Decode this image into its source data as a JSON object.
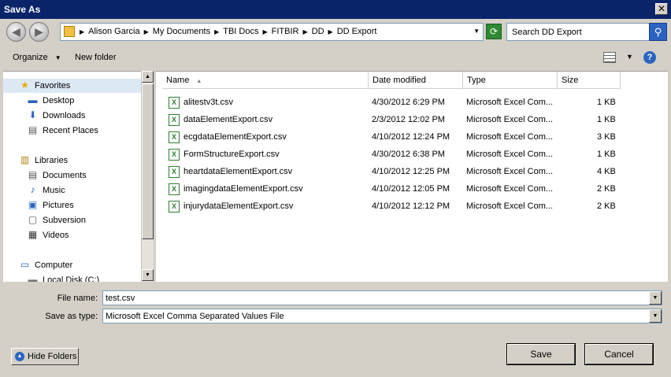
{
  "window": {
    "title": "Save As",
    "close_glyph": "✕"
  },
  "nav": {
    "back_glyph": "◀",
    "forward_glyph": "▶",
    "breadcrumbs": [
      "Alison Garcia",
      "My Documents",
      "TBI Docs",
      "FITBIR",
      "DD",
      "DD Export"
    ],
    "search_placeholder": "Search DD Export"
  },
  "toolbar": {
    "organize_label": "Organize",
    "new_folder_label": "New folder",
    "help_glyph": "?"
  },
  "sidebar": {
    "items": [
      {
        "label": "Favorites",
        "icon": "star-icon",
        "glyph": "★"
      },
      {
        "label": "Desktop",
        "icon": "desktop-icon",
        "glyph": "▬"
      },
      {
        "label": "Downloads",
        "icon": "downloads-icon",
        "glyph": "⬇"
      },
      {
        "label": "Recent Places",
        "icon": "recent-places-icon",
        "glyph": "▤"
      },
      {
        "label": "Libraries",
        "icon": "libraries-icon",
        "glyph": "▥"
      },
      {
        "label": "Documents",
        "icon": "documents-icon",
        "glyph": "▤"
      },
      {
        "label": "Music",
        "icon": "music-icon",
        "glyph": "♪"
      },
      {
        "label": "Pictures",
        "icon": "pictures-icon",
        "glyph": "▣"
      },
      {
        "label": "Subversion",
        "icon": "subversion-icon",
        "glyph": "▢"
      },
      {
        "label": "Videos",
        "icon": "videos-icon",
        "glyph": "▦"
      },
      {
        "label": "Computer",
        "icon": "computer-icon",
        "glyph": "▭"
      },
      {
        "label": "Local Disk (C:)",
        "icon": "local-disk-icon",
        "glyph": "▬"
      }
    ]
  },
  "file_list": {
    "columns": [
      "Name",
      "Date modified",
      "Type",
      "Size"
    ],
    "rows": [
      {
        "name": "alitestv3t.csv",
        "date": "4/30/2012 6:29 PM",
        "type": "Microsoft Excel Com...",
        "size": "1 KB"
      },
      {
        "name": "dataElementExport.csv",
        "date": "2/3/2012 12:02 PM",
        "type": "Microsoft Excel Com...",
        "size": "1 KB"
      },
      {
        "name": "ecgdataElementExport.csv",
        "date": "4/10/2012 12:24 PM",
        "type": "Microsoft Excel Com...",
        "size": "3 KB"
      },
      {
        "name": "FormStructureExport.csv",
        "date": "4/30/2012 6:38 PM",
        "type": "Microsoft Excel Com...",
        "size": "1 KB"
      },
      {
        "name": "heartdataElementExport.csv",
        "date": "4/10/2012 12:25 PM",
        "type": "Microsoft Excel Com...",
        "size": "4 KB"
      },
      {
        "name": "imagingdataElementExport.csv",
        "date": "4/10/2012 12:05 PM",
        "type": "Microsoft Excel Com...",
        "size": "2 KB"
      },
      {
        "name": "injurydataElementExport.csv",
        "date": "4/10/2012 12:12 PM",
        "type": "Microsoft Excel Com...",
        "size": "2 KB"
      }
    ]
  },
  "form": {
    "file_name_label": "File name:",
    "file_name_value": "test.csv",
    "save_type_label": "Save as type:",
    "save_type_value": "Microsoft Excel Comma Separated Values File"
  },
  "buttons": {
    "hide_folders": "Hide Folders",
    "save": "Save",
    "cancel": "Cancel"
  }
}
